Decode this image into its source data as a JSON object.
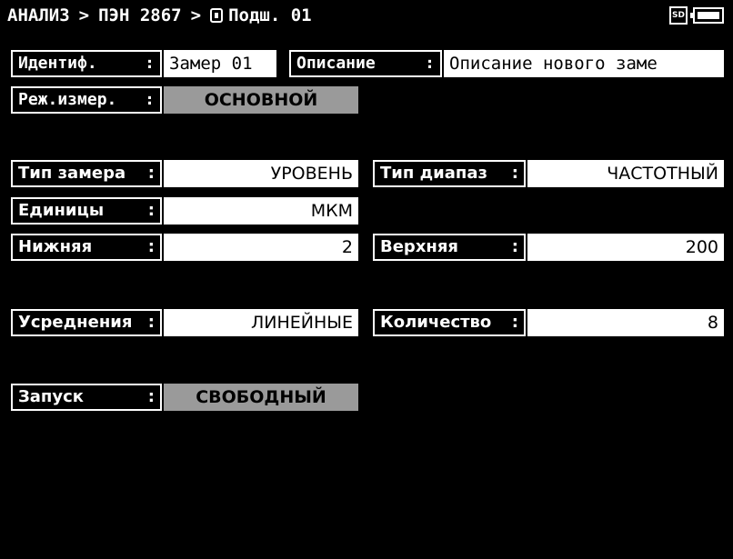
{
  "header": {
    "breadcrumb_1": "АНАЛИЗ",
    "sep_1": ">",
    "breadcrumb_2": "ПЭН 2867",
    "sep_2": ">",
    "breadcrumb_3": "Подш. 01",
    "sd_label": "SD"
  },
  "fields": {
    "ident": {
      "label": "Идентиф.",
      "colon": ":",
      "value": "Замер 01"
    },
    "description": {
      "label": "Описание",
      "colon": ":",
      "value": "Описание нового заме"
    },
    "mode": {
      "label": "Реж.измер.",
      "colon": ":",
      "value": "ОСНОВНОЙ"
    },
    "meas_type": {
      "label": "Тип замера",
      "colon": ":",
      "value": "УРОВЕНЬ"
    },
    "range_type": {
      "label": "Тип диапаз",
      "colon": ":",
      "value": "ЧАСТОТНЫЙ"
    },
    "units": {
      "label": "Единицы",
      "colon": ":",
      "value": "МКМ"
    },
    "lower": {
      "label": "Нижняя",
      "colon": ":",
      "value": "2"
    },
    "upper": {
      "label": "Верхняя",
      "colon": ":",
      "value": "200"
    },
    "averaging": {
      "label": "Усреднения",
      "colon": ":",
      "value": "ЛИНЕЙНЫЕ"
    },
    "count": {
      "label": "Количество",
      "colon": ":",
      "value": "8"
    },
    "trigger": {
      "label": "Запуск",
      "colon": ":",
      "value": "СВОБОДНЫЙ"
    }
  }
}
